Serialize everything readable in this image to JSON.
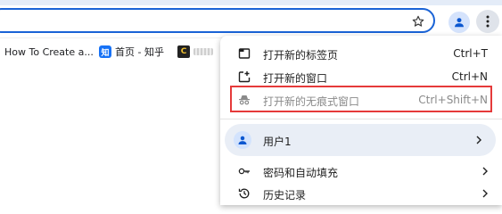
{
  "bookmarks": [
    {
      "label": "How To Create a..."
    },
    {
      "label": "首页 - 知乎",
      "icon_text": "知"
    },
    {
      "icon_text": "C"
    }
  ],
  "menu": {
    "items": [
      {
        "label": "打开新的标签页",
        "shortcut": "Ctrl+T",
        "icon": "new-tab-icon"
      },
      {
        "label": "打开新的窗口",
        "shortcut": "Ctrl+N",
        "icon": "new-window-icon"
      },
      {
        "label": "打开新的无痕式窗口",
        "shortcut": "Ctrl+Shift+N",
        "icon": "incognito-icon",
        "state": "disabled"
      }
    ],
    "profile": {
      "label": "用户1",
      "icon": "person-icon"
    },
    "lower_items": [
      {
        "label": "密码和自动填充",
        "icon": "key-icon"
      },
      {
        "label": "历史记录",
        "icon": "history-icon"
      }
    ]
  },
  "colors": {
    "accent": "#1a63d6",
    "highlight_border": "#e53a3a",
    "profile_bg": "#e9eef6"
  }
}
